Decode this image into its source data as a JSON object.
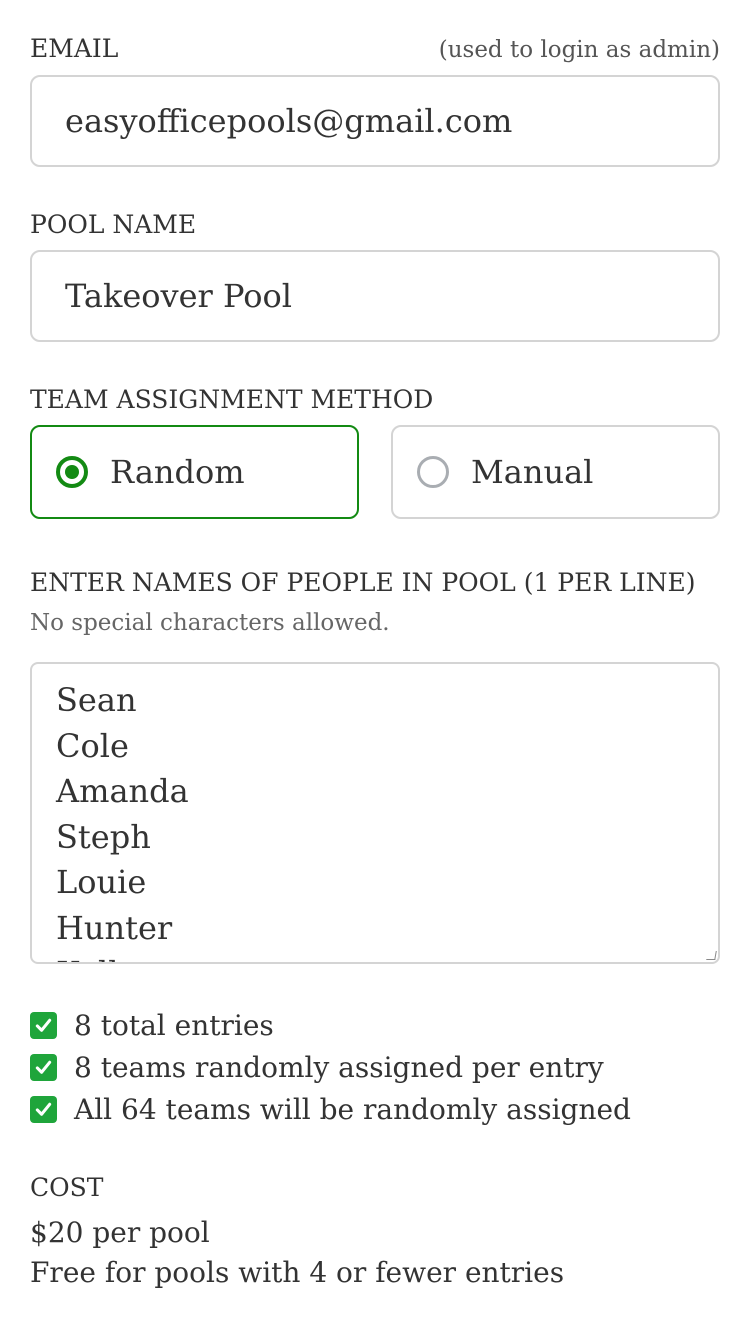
{
  "email": {
    "label": "EMAIL",
    "hint": "(used to login as admin)",
    "value": "easyofficepools@gmail.com"
  },
  "pool_name": {
    "label": "POOL NAME",
    "value": "Takeover Pool"
  },
  "team_assignment": {
    "label": "TEAM ASSIGNMENT METHOD",
    "options": [
      {
        "label": "Random",
        "selected": true
      },
      {
        "label": "Manual",
        "selected": false
      }
    ],
    "accent_color": "#138a13"
  },
  "names": {
    "label": "ENTER NAMES OF PEOPLE IN POOL (1 PER LINE)",
    "note": "No special characters allowed.",
    "entries": [
      "Sean",
      "Cole",
      "Amanda",
      "Steph",
      "Louie",
      "Hunter",
      "Kelly"
    ]
  },
  "summary": {
    "icon": "check-mark-button-icon",
    "icon_color": "#1fa53b",
    "items": [
      "8 total entries",
      "8 teams randomly assigned per entry",
      "All 64 teams will be randomly assigned"
    ]
  },
  "cost": {
    "label": "COST",
    "price": "$20 per pool",
    "note": "Free for pools with 4 or fewer entries"
  }
}
